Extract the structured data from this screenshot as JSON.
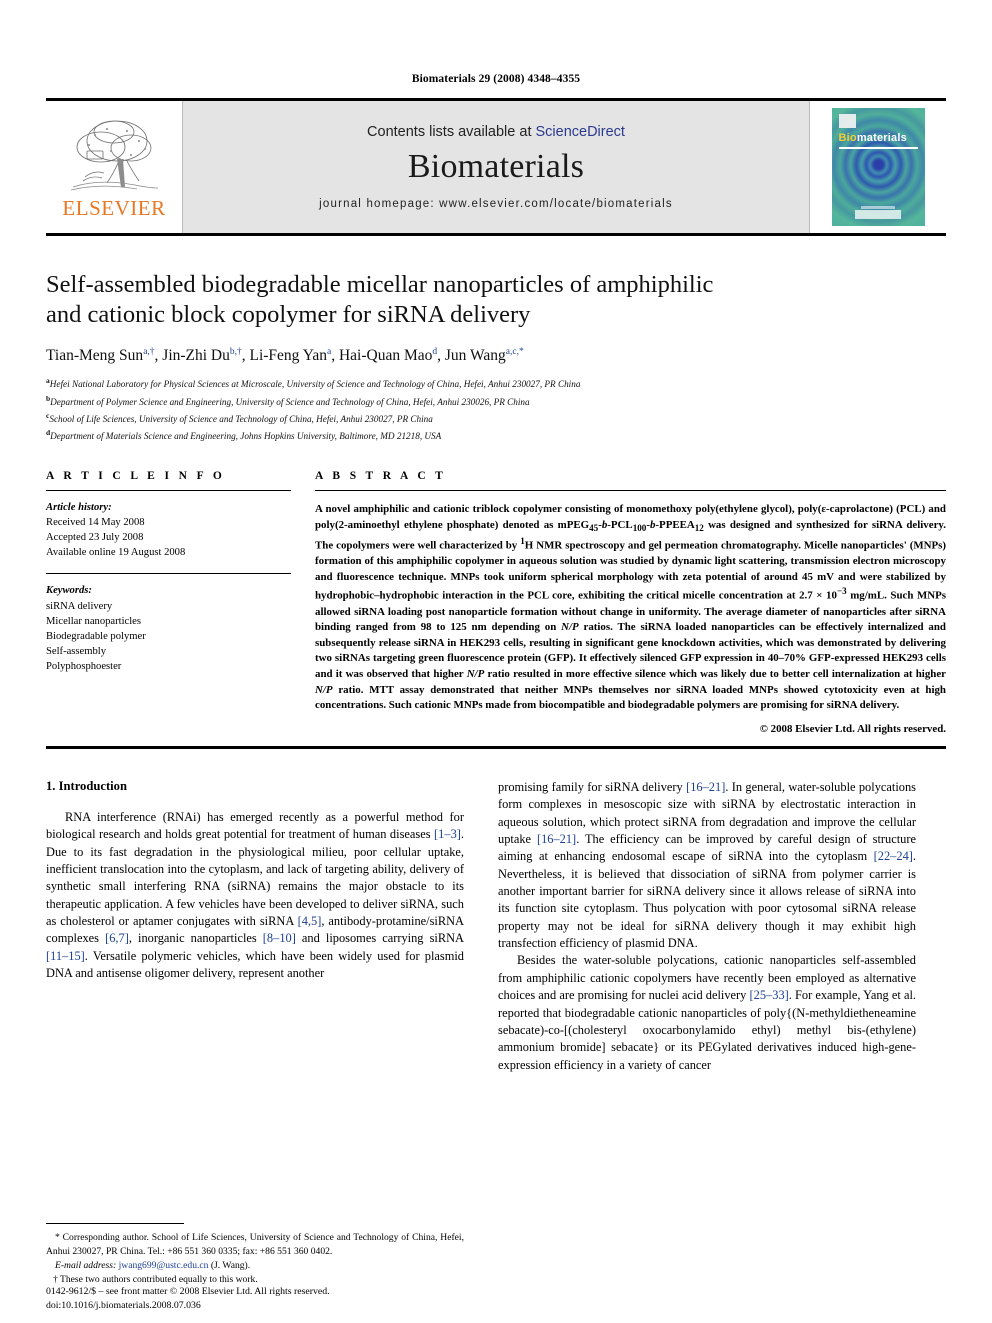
{
  "running_head": "Biomaterials 29 (2008) 4348–4355",
  "masthead": {
    "contents_prefix": "Contents lists available at ",
    "contents_link": "ScienceDirect",
    "journal_name": "Biomaterials",
    "homepage": "journal homepage: www.elsevier.com/locate/biomaterials",
    "publisher_logo_text": "ELSEVIER",
    "publisher_logo_color": "#E87722",
    "link_color": "#2b3a8f",
    "cover_title_a": "Bio",
    "cover_title_b": "materials"
  },
  "article": {
    "title_line1": "Self-assembled biodegradable micellar nanoparticles of amphiphilic",
    "title_line2": "and cationic block copolymer for siRNA delivery",
    "authors": [
      {
        "name": "Tian-Meng Sun",
        "sup": "a,†",
        "sep": ", "
      },
      {
        "name": "Jin-Zhi Du",
        "sup": "b,†",
        "sep": ", "
      },
      {
        "name": "Li-Feng Yan",
        "sup": "a",
        "sep": ", "
      },
      {
        "name": "Hai-Quan Mao",
        "sup": "d",
        "sep": ", "
      },
      {
        "name": "Jun Wang",
        "sup": "a,c,*",
        "sep": ""
      }
    ],
    "affiliations": [
      {
        "label": "a",
        "text": "Hefei National Laboratory for Physical Sciences at Microscale, University of Science and Technology of China, Hefei, Anhui 230027, PR China"
      },
      {
        "label": "b",
        "text": "Department of Polymer Science and Engineering, University of Science and Technology of China, Hefei, Anhui 230026, PR China"
      },
      {
        "label": "c",
        "text": "School of Life Sciences, University of Science and Technology of China, Hefei, Anhui 230027, PR China"
      },
      {
        "label": "d",
        "text": "Department of Materials Science and Engineering, Johns Hopkins University, Baltimore, MD 21218, USA"
      }
    ]
  },
  "article_info": {
    "heading": "A R T I C L E   I N F O",
    "history_label": "Article history:",
    "history": [
      "Received 14 May 2008",
      "Accepted 23 July 2008",
      "Available online 19 August 2008"
    ],
    "keywords_label": "Keywords:",
    "keywords": [
      "siRNA delivery",
      "Micellar nanoparticles",
      "Biodegradable polymer",
      "Self-assembly",
      "Polyphosphoester"
    ]
  },
  "abstract": {
    "heading": "A B S T R A C T",
    "text_part1": "A novel amphiphilic and cationic triblock copolymer consisting of monomethoxy poly(ethylene glycol), poly(ε-caprolactone) (PCL) and poly(2-aminoethyl ethylene phosphate) denoted as mPEG",
    "sub45": "45",
    "mid1": "-",
    "b1": "b",
    "mid2": "-PCL",
    "sub100": "100",
    "mid3": "-",
    "b2": "b",
    "mid4": "-PPEEA",
    "sub12": "12",
    "text_part2": " was designed and synthesized for siRNA delivery. The copolymers were well characterized by ",
    "sup1": "1",
    "text_part3": "H NMR spectroscopy and gel permeation chromatography. Micelle nanoparticles' (MNPs) formation of this amphiphilic copolymer in aqueous solution was studied by dynamic light scattering, transmission electron microscopy and fluorescence technique. MNPs took uniform spherical morphology with zeta potential of around 45 mV and were stabilized by hydrophobic–hydrophobic interaction in the PCL core, exhibiting the critical micelle concentration at 2.7 × 10",
    "supneg3": "−3",
    "text_part4": " mg/mL. Such MNPs allowed siRNA loading post nanoparticle formation without change in uniformity. The average diameter of nanoparticles after siRNA binding ranged from 98 to 125 nm depending on ",
    "np1": "N/P",
    "text_part5": " ratios. The siRNA loaded nanoparticles can be effectively internalized and subsequently release siRNA in HEK293 cells, resulting in significant gene knockdown activities, which was demonstrated by delivering two siRNAs targeting green fluorescence protein (GFP). It effectively silenced GFP expression in 40–70% GFP-expressed HEK293 cells and it was observed that higher ",
    "np2": "N/P",
    "text_part6": " ratio resulted in more effective silence which was likely due to better cell internalization at higher ",
    "np3": "N/P",
    "text_part7": " ratio. MTT assay demonstrated that neither MNPs themselves nor siRNA loaded MNPs showed cytotoxicity even at high concentrations. Such cationic MNPs made from biocompatible and biodegradable polymers are promising for siRNA delivery.",
    "copyright": "© 2008 Elsevier Ltd. All rights reserved."
  },
  "introduction": {
    "heading": "1. Introduction",
    "left_para1_a": "RNA interference (RNAi) has emerged recently as a powerful method for biological research and holds great potential for treatment of human diseases ",
    "left_ref1": "[1–3]",
    "left_para1_b": ". Due to its fast degradation in the physiological milieu, poor cellular uptake, inefficient translocation into the cytoplasm, and lack of targeting ability, delivery of synthetic small interfering RNA (siRNA) remains the major obstacle to its therapeutic application. A few vehicles have been developed to deliver siRNA, such as cholesterol or aptamer conjugates with siRNA ",
    "left_ref2": "[4,5]",
    "left_para1_c": ", antibody-protamine/siRNA complexes ",
    "left_ref3": "[6,7]",
    "left_para1_d": ", inorganic nanoparticles ",
    "left_ref4": "[8–10]",
    "left_para1_e": " and liposomes carrying siRNA ",
    "left_ref5": "[11–15]",
    "left_para1_f": ". Versatile polymeric vehicles, which have been widely used for plasmid DNA and antisense oligomer delivery, represent another",
    "right_para1_a": "promising family for siRNA delivery ",
    "right_ref1": "[16–21]",
    "right_para1_b": ". In general, water-soluble polycations form complexes in mesoscopic size with siRNA by electrostatic interaction in aqueous solution, which protect siRNA from degradation and improve the cellular uptake ",
    "right_ref2": "[16–21]",
    "right_para1_c": ". The efficiency can be improved by careful design of structure aiming at enhancing endosomal escape of siRNA into the cytoplasm ",
    "right_ref3": "[22–24]",
    "right_para1_d": ". Nevertheless, it is believed that dissociation of siRNA from polymer carrier is another important barrier for siRNA delivery since it allows release of siRNA into its function site cytoplasm. Thus polycation with poor cytosomal siRNA release property may not be ideal for siRNA delivery though it may exhibit high transfection efficiency of plasmid DNA.",
    "right_para2_a": "Besides the water-soluble polycations, cationic nanoparticles self-assembled from amphiphilic cationic copolymers have recently been employed as alternative choices and are promising for nuclei acid delivery ",
    "right_ref4": "[25–33]",
    "right_para2_b": ". For example, Yang et al. reported that biodegradable cationic nanoparticles of poly{(",
    "right_italic_N": "N",
    "right_para2_c": "-methyldietheneamine sebacate)-co-[(cholesteryl oxocarbonylamido ethyl) methyl bis-(ethylene) ammonium bromide] sebacate} or its PEGylated derivatives induced high-gene-expression efficiency in a variety of cancer"
  },
  "footnotes": {
    "corresponding_marker": "*",
    "corresponding": " Corresponding author. School of Life Sciences, University of Science and Technology of China, Hefei, Anhui 230027, PR China. Tel.: +86 551 360 0335; fax: +86 551 360 0402.",
    "email_label": "E-mail address:",
    "email": "jwang699@ustc.edu.cn",
    "email_suffix": " (J. Wang).",
    "equal_marker": "†",
    "equal_contrib": " These two authors contributed equally to this work."
  },
  "imprint": {
    "line1": "0142-9612/$ – see front matter © 2008 Elsevier Ltd. All rights reserved.",
    "line2": "doi:10.1016/j.biomaterials.2008.07.036"
  }
}
